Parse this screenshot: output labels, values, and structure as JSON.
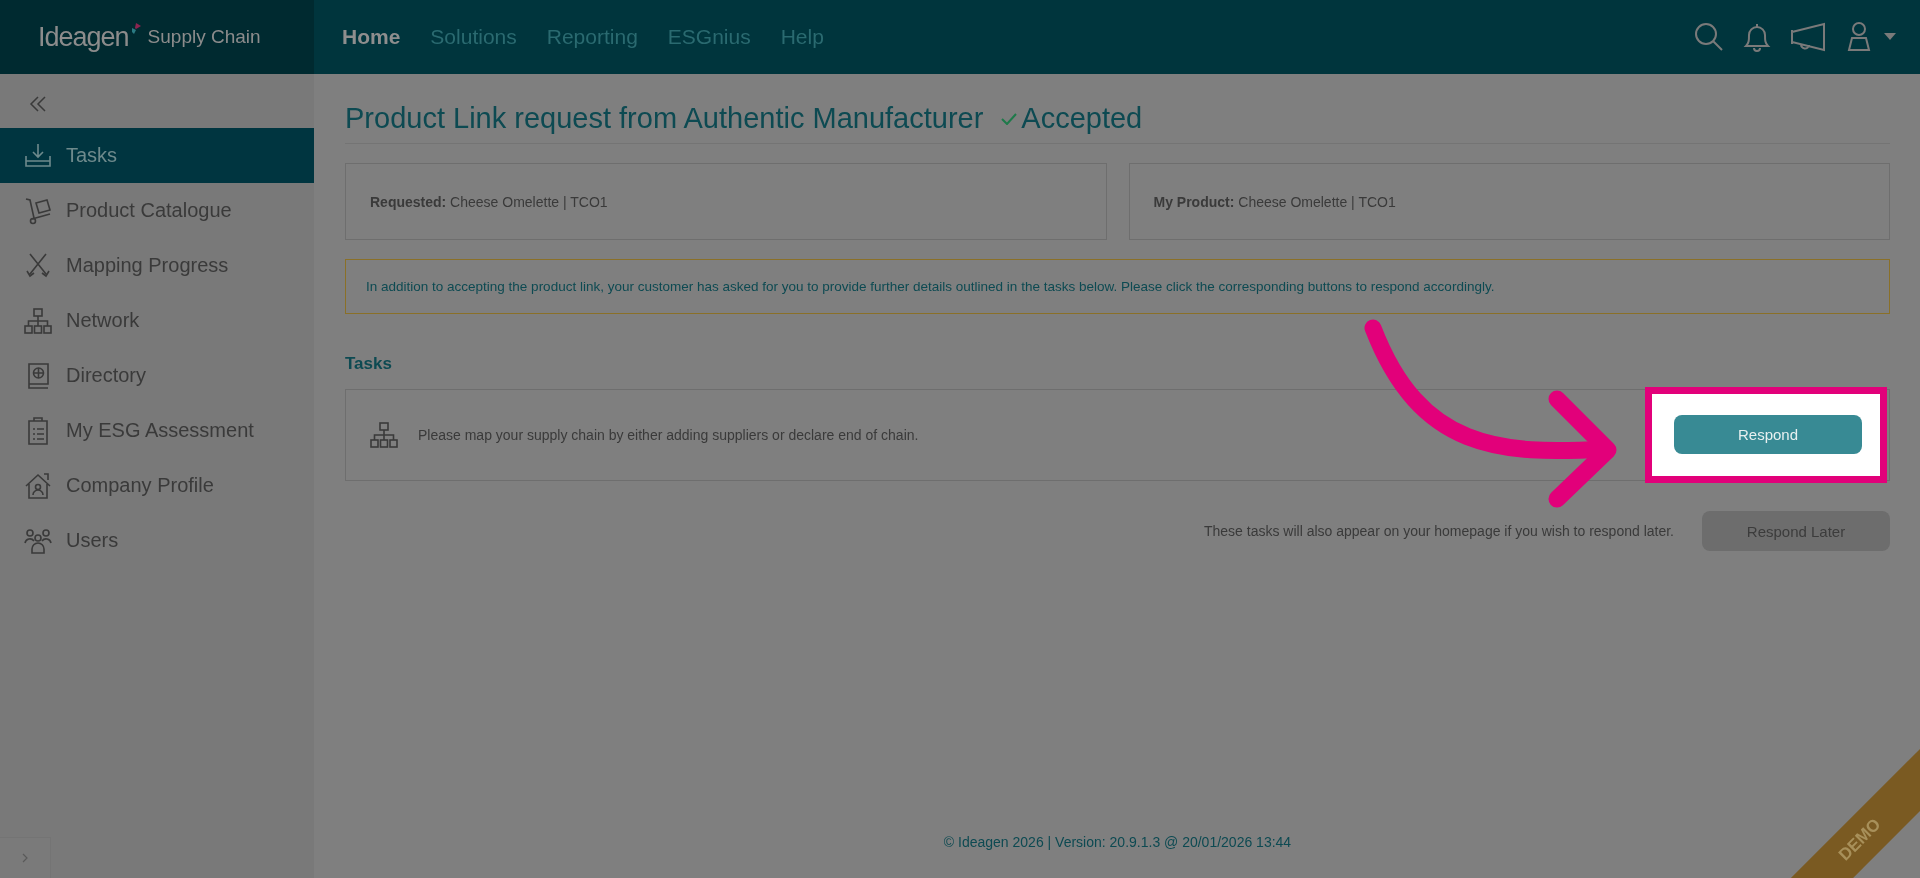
{
  "header": {
    "logo": {
      "brand": "Ideagen",
      "product": "Supply Chain"
    },
    "nav": [
      {
        "label": "Home",
        "selected": true
      },
      {
        "label": "Solutions",
        "selected": false
      },
      {
        "label": "Reporting",
        "selected": false
      },
      {
        "label": "ESGnius",
        "selected": false
      },
      {
        "label": "Help",
        "selected": false
      }
    ]
  },
  "sidebar": {
    "items": [
      {
        "label": "Tasks",
        "selected": true
      },
      {
        "label": "Product Catalogue",
        "selected": false
      },
      {
        "label": "Mapping Progress",
        "selected": false
      },
      {
        "label": "Network",
        "selected": false
      },
      {
        "label": "Directory",
        "selected": false
      },
      {
        "label": "My ESG Assessment",
        "selected": false
      },
      {
        "label": "Company Profile",
        "selected": false
      },
      {
        "label": "Users",
        "selected": false
      }
    ]
  },
  "page": {
    "title": "Product Link request from Authentic Manufacturer",
    "status": "Accepted",
    "details": [
      {
        "label": "Requested:",
        "value": "Cheese Omelette | TCO1"
      },
      {
        "label": "My Product:",
        "value": "Cheese Omelette | TCO1"
      }
    ],
    "notice": "In addition to accepting the product link, your customer has asked for you to provide further details outlined in the tasks below. Please click the corresponding buttons to respond accordingly.",
    "tasks_heading": "Tasks",
    "tasks": [
      {
        "text": "Please map your supply chain by either adding suppliers or declare end of chain.",
        "button": "Respond",
        "highlighted": true
      }
    ],
    "later_note": "These tasks will also appear on your homepage if you wish to respond later.",
    "later_button": "Respond Later"
  },
  "footer": "© Ideagen 2026 | Version: 20.9.1.3 @ 20/01/2026 13:44",
  "ribbon": "DEMO"
}
